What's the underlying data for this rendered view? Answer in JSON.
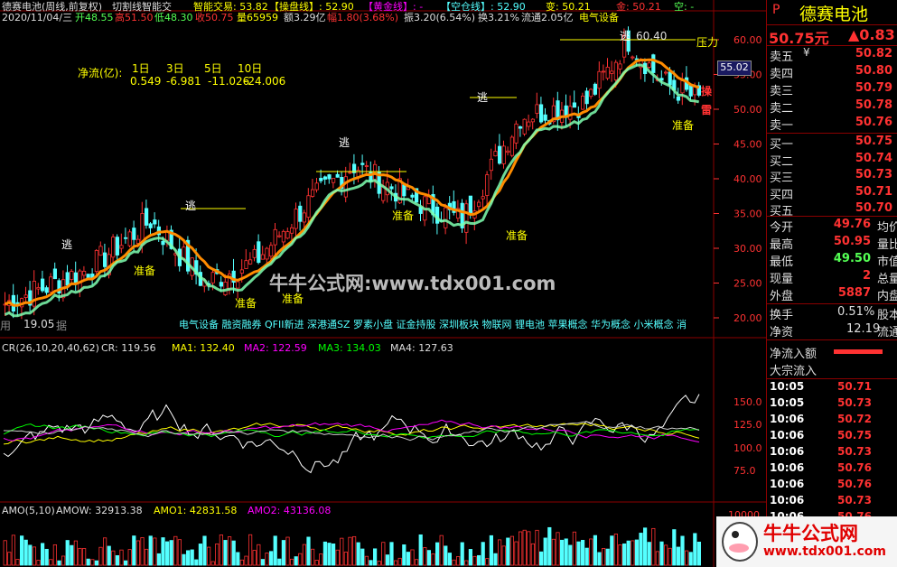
{
  "header": {
    "stock": "德赛电池(周线,前复权)",
    "indicator": "切割线智能交",
    "smart_trade": "智能交易: 53.82",
    "operating_line": "【操盘线】: 52.90",
    "golden_line": "【黄金线】: -",
    "short_line": "【空仓线】: 52.90",
    "change_label": "变: 50.21",
    "gold_label": "金: 50.21",
    "empty_label": "空: -",
    "date": "2020/11/04/三",
    "open": "开48.55",
    "high": "高51.50",
    "low": "低48.30",
    "close": "收50.75",
    "volume": "量65959",
    "amount": "额3.29亿",
    "amplitude": "幅1.80(3.68%)",
    "swing": "振3.20(6.54%)",
    "turnover": "换3.21%",
    "float": "流通2.05亿",
    "sector": "电气设备"
  },
  "netflow": {
    "label": "净流(亿):",
    "periods": [
      "1日",
      "3日",
      "5日",
      "10日"
    ],
    "values": [
      "0.549",
      "-6.981",
      "-11.026",
      "-24.006"
    ]
  },
  "price_axis": [
    "60.00",
    "55.00",
    "50.00",
    "45.00",
    "40.00",
    "35.00",
    "30.00",
    "25.00",
    "20.00"
  ],
  "current_price_box": "55.02",
  "price_annotations": {
    "pressure": "压力",
    "flee": "逃",
    "prepare": "准备",
    "peak": "60.40",
    "low_mark": "19.05",
    "operate": "操",
    "thunder": "雷"
  },
  "concept_tags": [
    "电气设备",
    "融资融券",
    "QFII新进",
    "深港通SZ",
    "罗素小盘",
    "证金持股",
    "深圳板块",
    "物联网",
    "锂电池",
    "苹果概念",
    "华为概念",
    "小米概念"
  ],
  "concept_tail": "消",
  "watermark": "牛牛公式网:www.tdx001.com",
  "left_bottom_text": "用",
  "left_bottom_text2": "据",
  "cr_panel": {
    "title": "CR(26,10,20,40,62)",
    "cr": "CR: 119.56",
    "ma1": "MA1: 132.40",
    "ma2": "MA2: 122.59",
    "ma3": "MA3: 134.03",
    "ma4": "MA4: 127.63",
    "axis": [
      "150.0",
      "125.0",
      "100.0",
      "75.0"
    ]
  },
  "amo_panel": {
    "title": "AMO(5,10)",
    "amow": "AMOW: 32913.38",
    "amo1": "AMO1: 42831.58",
    "amo2": "AMO2: 43136.08",
    "axis": [
      "10000"
    ]
  },
  "sidebar": {
    "p_label": "P",
    "name": "德赛电池",
    "price": "50.75元",
    "change": "▲0.83",
    "asks": [
      {
        "label": "卖五",
        "flag": "¥",
        "price": "50.82"
      },
      {
        "label": "卖四",
        "flag": "",
        "price": "50.80"
      },
      {
        "label": "卖三",
        "flag": "",
        "price": "50.79"
      },
      {
        "label": "卖二",
        "flag": "",
        "price": "50.78"
      },
      {
        "label": "卖一",
        "flag": "",
        "price": "50.76"
      }
    ],
    "bids": [
      {
        "label": "买一",
        "price": "50.75"
      },
      {
        "label": "买二",
        "price": "50.74"
      },
      {
        "label": "买三",
        "price": "50.73"
      },
      {
        "label": "买四",
        "price": "50.71"
      },
      {
        "label": "买五",
        "price": "50.70"
      }
    ],
    "stats": [
      {
        "label": "今开",
        "value": "49.76",
        "extra": "均价"
      },
      {
        "label": "最高",
        "value": "50.95",
        "extra": "量比"
      },
      {
        "label": "最低",
        "value": "49.50",
        "extra": "市值"
      },
      {
        "label": "现量",
        "value": "2",
        "extra": "总量"
      },
      {
        "label": "外盘",
        "value": "5887",
        "extra": "内盘"
      }
    ],
    "turnover": {
      "label": "换手",
      "value": "0.51%",
      "extra": "股本"
    },
    "net_asset": {
      "label": "净资",
      "value": "12.19",
      "extra": "流通"
    },
    "netflow_label": "净流入额",
    "bigdeal_label": "大宗流入",
    "ticks": [
      {
        "time": "10:05",
        "price": "50.71"
      },
      {
        "time": "10:05",
        "price": "50.73"
      },
      {
        "time": "10:06",
        "price": "50.72"
      },
      {
        "time": "10:06",
        "price": "50.75"
      },
      {
        "time": "10:06",
        "price": "50.73"
      },
      {
        "time": "10:06",
        "price": "50.76"
      },
      {
        "time": "10:06",
        "price": "50.76"
      },
      {
        "time": "10:06",
        "price": "50.73"
      },
      {
        "time": "10:06",
        "price": "50.76"
      }
    ],
    "logo_text": "牛牛公式网",
    "logo_url": "www.tdx001.com"
  },
  "colors": {
    "up": "#ff3232",
    "down": "#54ffff",
    "yellow": "#ffff00",
    "magenta": "#ff00ff",
    "green": "#00ff00",
    "orange": "#ff8c00",
    "panel_border": "#8b0000"
  }
}
